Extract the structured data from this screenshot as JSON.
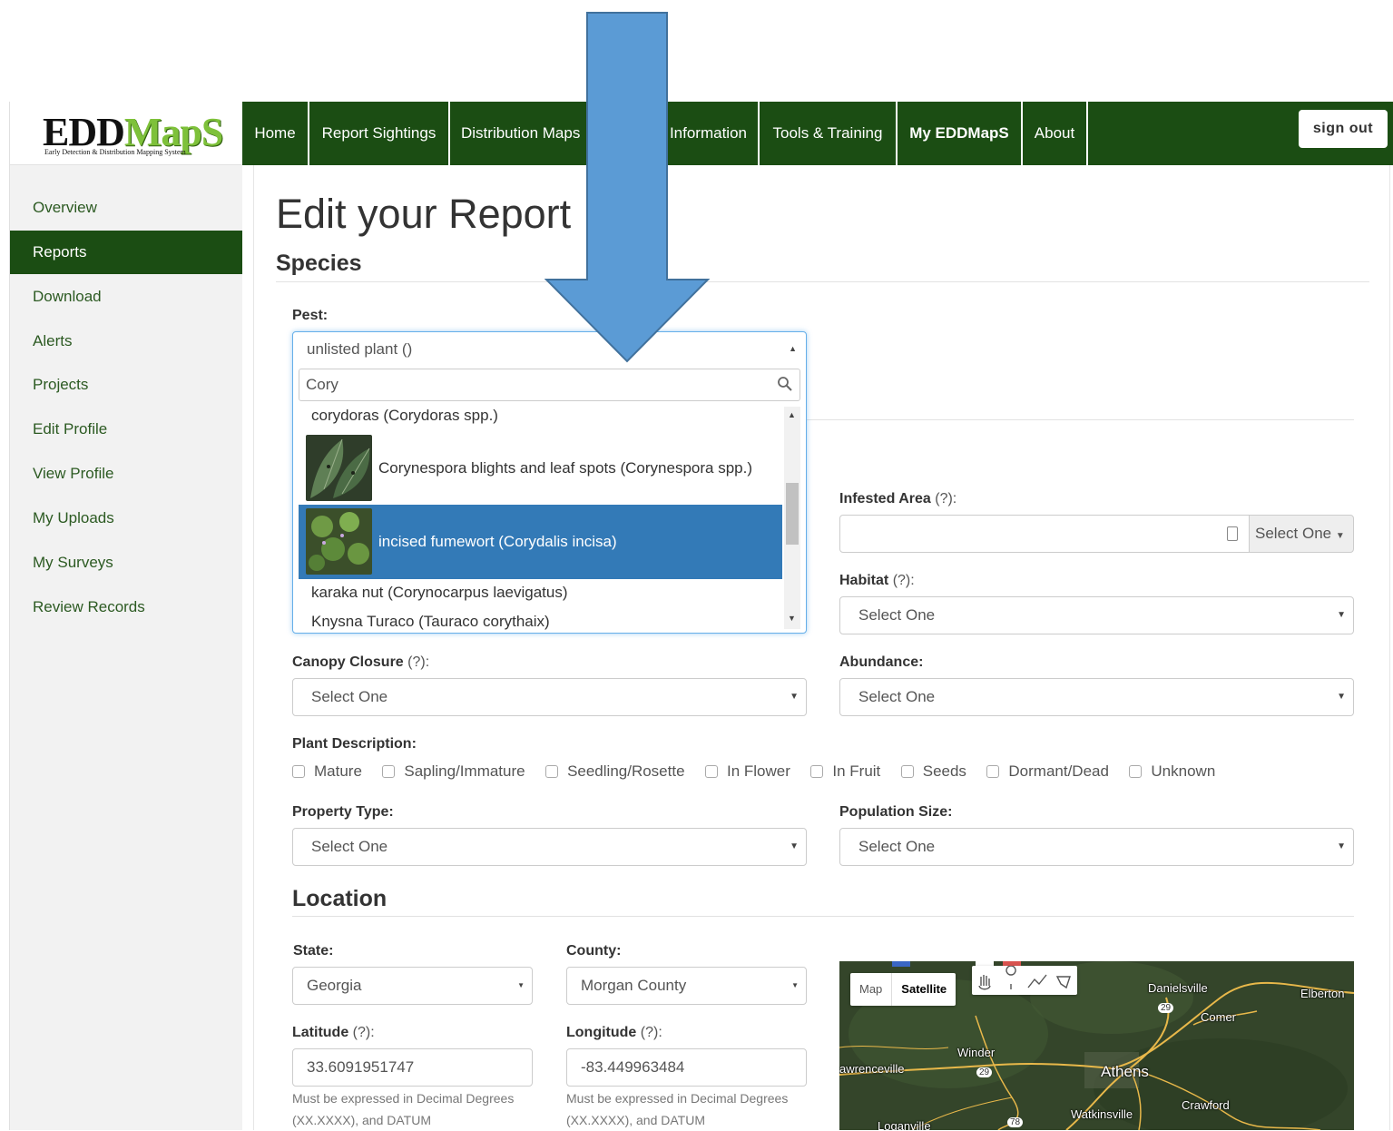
{
  "logo": {
    "main_a": "EDD",
    "main_b": "MapS",
    "tagline": "Early Detection & Distribution Mapping System"
  },
  "nav": {
    "items": [
      "Home",
      "Report Sightings",
      "Distribution Maps",
      "Information",
      "Tools & Training",
      "My EDDMapS",
      "About"
    ],
    "sign_out": "sign out"
  },
  "sidebar": {
    "items": [
      "Overview",
      "Reports",
      "Download",
      "Alerts",
      "Projects",
      "Edit Profile",
      "View Profile",
      "My Uploads",
      "My Surveys",
      "Review Records"
    ],
    "active": "Reports"
  },
  "page": {
    "title": "Edit your Report"
  },
  "species": {
    "heading": "Species",
    "pest_label": "Pest:",
    "pest_value": "unlisted plant ()",
    "search_value": "Cory",
    "options": [
      "corydoras (Corydoras spp.)",
      "Corynespora blights and leaf spots (Corynespora spp.)",
      "incised fumewort (Corydalis incisa)",
      "karaka nut (Corynocarpus laevigatus)",
      "Knysna Turaco (Tauraco corythaix)"
    ],
    "highlighted_option": "incised fumewort (Corydalis incisa)"
  },
  "fields": {
    "infested_area": {
      "label": "Infested Area",
      "hint": "(?):",
      "unit": "Select One"
    },
    "habitat": {
      "label": "Habitat",
      "hint": "(?):",
      "value": "Select One"
    },
    "canopy": {
      "label": "Canopy Closure",
      "hint": "(?):",
      "value": "Select One"
    },
    "abundance": {
      "label": "Abundance:",
      "value": "Select One"
    },
    "plant_description": {
      "label": "Plant Description:",
      "options": [
        "Mature",
        "Sapling/Immature",
        "Seedling/Rosette",
        "In Flower",
        "In Fruit",
        "Seeds",
        "Dormant/Dead",
        "Unknown"
      ]
    },
    "property_type": {
      "label": "Property Type:",
      "value": "Select One"
    },
    "population_size": {
      "label": "Population Size:",
      "value": "Select One"
    }
  },
  "location": {
    "heading": "Location",
    "state": {
      "label": "State:",
      "value": "Georgia"
    },
    "county": {
      "label": "County:",
      "value": "Morgan County"
    },
    "latitude": {
      "label": "Latitude",
      "hint": "(?):",
      "value": "33.6091951747",
      "help": "Must be expressed in Decimal Degrees (XX.XXXX), and DATUM"
    },
    "longitude": {
      "label": "Longitude",
      "hint": "(?):",
      "value": "-83.449963484",
      "help": "Must be expressed in Decimal Degrees (XX.XXXX), and DATUM"
    }
  },
  "map": {
    "type_buttons": [
      "Map",
      "Satellite"
    ],
    "labels": [
      "Danielsville",
      "Elberton",
      "Comer",
      "Winder",
      "Athens",
      "awrenceville",
      "Crawford",
      "Watkinsville",
      "Loganville",
      "29",
      "29",
      "78"
    ],
    "colors": {
      "terrain": "#34452a",
      "roads": "#e8b84a"
    }
  },
  "colors": {
    "brand_green": "#1b4d13",
    "highlight_blue": "#337ab7",
    "arrow_blue": "#5b9bd5"
  }
}
